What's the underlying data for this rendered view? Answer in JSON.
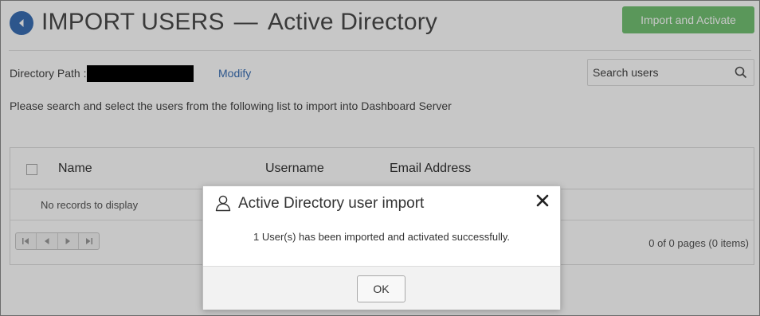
{
  "header": {
    "title_main": "IMPORT USERS",
    "title_sep": "—",
    "title_sub": "Active Directory",
    "import_button": "Import and Activate"
  },
  "directory": {
    "label": "Directory Path :",
    "modify_link": "Modify"
  },
  "search": {
    "placeholder": "Search users"
  },
  "instruction": "Please search and select the users from the following list to import into Dashboard Server",
  "grid": {
    "columns": [
      "Name",
      "Username",
      "Email Address"
    ],
    "empty_text": "No records to display",
    "page_info": "0 of 0 pages (0 items)"
  },
  "modal": {
    "title": "Active Directory user import",
    "message": "1 User(s) has been imported and activated successfully.",
    "ok_button": "OK"
  },
  "icons": {
    "back": "back-arrow-icon",
    "search": "search-icon",
    "user": "user-icon",
    "close": "close-icon"
  },
  "colors": {
    "accent": "#3a6fb4",
    "success": "#5cb85c"
  }
}
